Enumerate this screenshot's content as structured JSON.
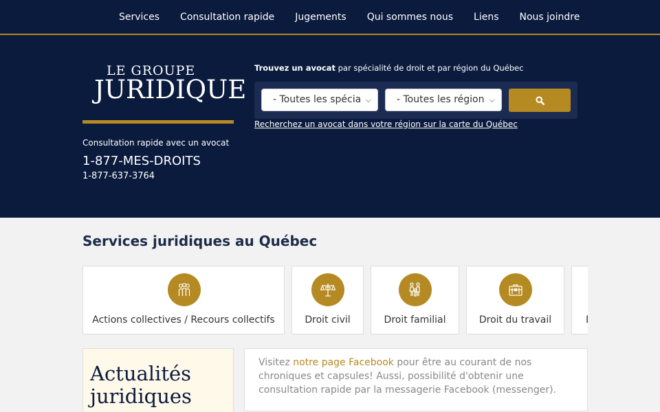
{
  "nav": {
    "items": [
      {
        "label": "Services"
      },
      {
        "label": "Consultation rapide"
      },
      {
        "label": "Jugements"
      },
      {
        "label": "Qui sommes nous"
      },
      {
        "label": "Liens"
      },
      {
        "label": "Nous joindre"
      }
    ]
  },
  "logo": {
    "line1": "LE GROUPE",
    "line2": "JURIDIQUE"
  },
  "contact": {
    "label": "Consultation rapide avec un avocat",
    "phone_main": "1-877-MES-DROITS",
    "phone_alt": "1-877-637-3764"
  },
  "finder": {
    "title_bold": "Trouvez un avocat",
    "title_rest": " par spécialité de droit et par région du Québec",
    "specialty_value": "- Toutes les spécia",
    "region_value": "- Toutes les région",
    "map_link": "Recherchez un avocat dans votre région sur la carte du Québec"
  },
  "services": {
    "title": "Services juridiques au Québec",
    "cards": [
      {
        "label": "Actions collectives / Recours collectifs",
        "icon": "group-icon"
      },
      {
        "label": "Droit civil",
        "icon": "scales-icon"
      },
      {
        "label": "Droit familial",
        "icon": "family-icon"
      },
      {
        "label": "Droit du travail",
        "icon": "briefcase-icon"
      },
      {
        "label": "D",
        "icon": "partial-icon"
      }
    ]
  },
  "news": {
    "title": "Actualités juridiques"
  },
  "facebook": {
    "pre": "Visitez ",
    "link": "notre page Facebook",
    "post": " pour être au courant de nos chroniques et capsules! Aussi, possibilité d'obtenir une consultation rapide par la messagerie Facebook (messenger)."
  },
  "colors": {
    "navy": "#0b1b3e",
    "gold": "#b58a22"
  }
}
